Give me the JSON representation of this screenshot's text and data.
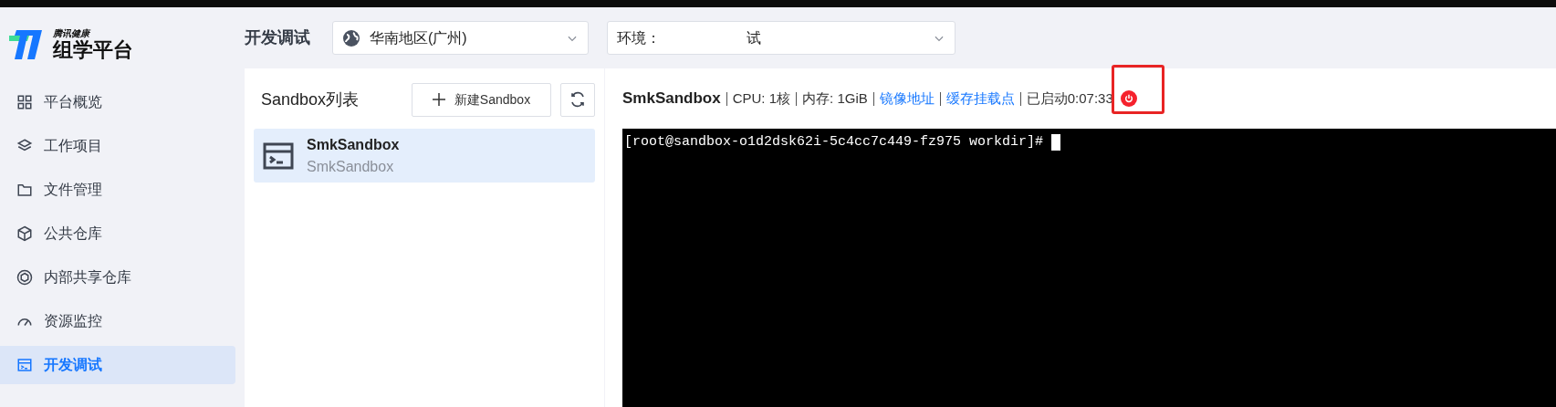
{
  "logo": {
    "brand": "腾讯健康",
    "title": "组学平台"
  },
  "sidebar": {
    "items": [
      {
        "label": "平台概览",
        "selected": false
      },
      {
        "label": "工作项目",
        "selected": false
      },
      {
        "label": "文件管理",
        "selected": false
      },
      {
        "label": "公共仓库",
        "selected": false
      },
      {
        "label": "内部共享仓库",
        "selected": false
      },
      {
        "label": "资源监控",
        "selected": false
      },
      {
        "label": "开发调试",
        "selected": true
      }
    ]
  },
  "topbar": {
    "title": "开发调试",
    "region": {
      "value": "华南地区(广州)"
    },
    "environment": {
      "label": "环境：",
      "value": "试"
    }
  },
  "sandbox_list": {
    "title": "Sandbox列表",
    "new_button": "新建Sandbox",
    "items": [
      {
        "name": "SmkSandbox",
        "subtitle": "SmkSandbox",
        "selected": true
      }
    ]
  },
  "detail": {
    "name": "SmkSandbox",
    "parts": [
      {
        "kind": "text",
        "text": "CPU: 1核"
      },
      {
        "kind": "text",
        "text": "内存: 1GiB"
      },
      {
        "kind": "link",
        "text": "镜像地址"
      },
      {
        "kind": "link",
        "text": "缓存挂载点"
      },
      {
        "kind": "text",
        "text": "已启动0:07:33"
      }
    ],
    "power": {
      "highlighted": true
    }
  },
  "terminal": {
    "lines": [
      "[root@sandbox-o1d2dsk62i-5c4cc7c449-fz975 workdir]# "
    ]
  }
}
